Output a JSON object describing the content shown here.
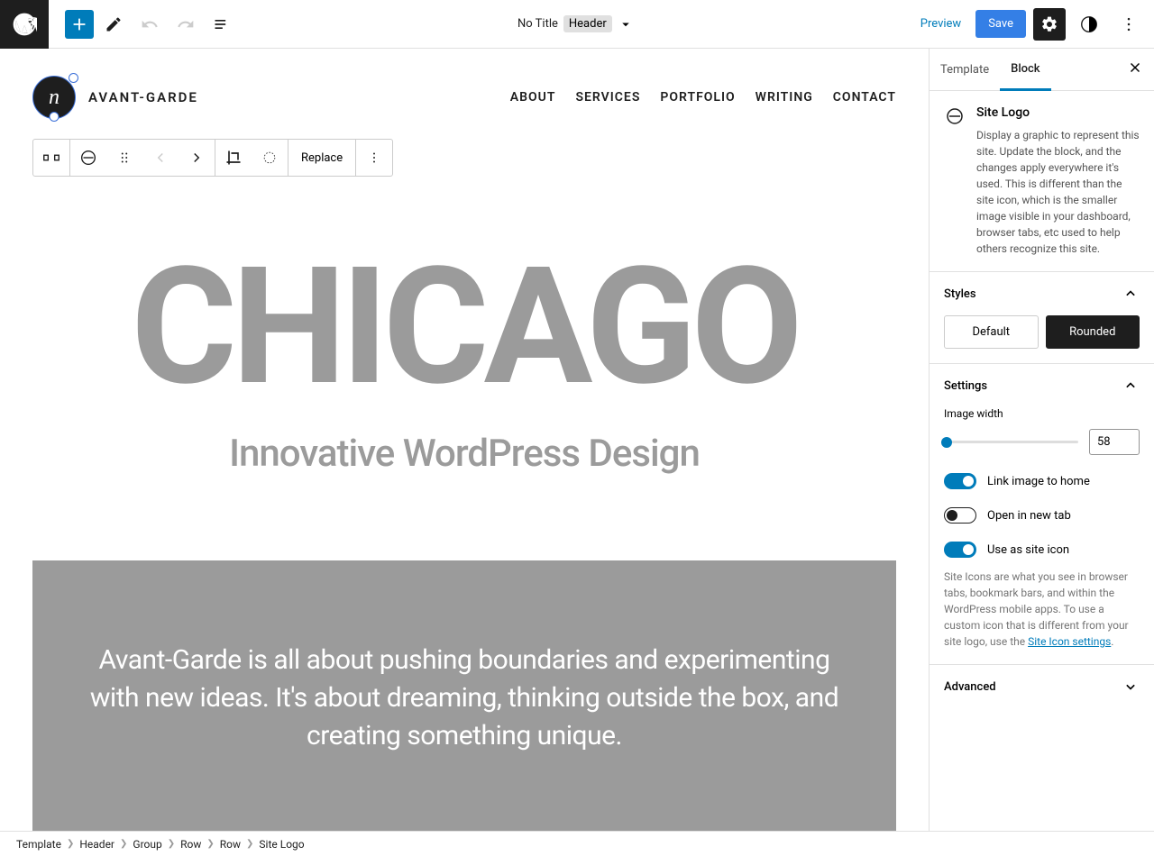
{
  "toolbar": {
    "doc_title": "No Title",
    "doc_part": "Header",
    "preview": "Preview",
    "save": "Save"
  },
  "site": {
    "title": "AVANT-GARDE",
    "nav": [
      "ABOUT",
      "SERVICES",
      "PORTFOLIO",
      "WRITING",
      "CONTACT"
    ]
  },
  "block_toolbar": {
    "replace": "Replace"
  },
  "hero": {
    "title": "CHICAGO",
    "subtitle": "Innovative WordPress Design",
    "blurb": "Avant-Garde is all about pushing boundaries and experimenting with new ideas. It's about dreaming, thinking outside the box, and creating something unique."
  },
  "sidebar": {
    "tab_template": "Template",
    "tab_block": "Block",
    "block_name": "Site Logo",
    "block_desc": "Display a graphic to represent this site. Update the block, and the changes apply everywhere it's used. This is different than the site icon, which is the smaller image visible in your dashboard, browser tabs, etc used to help others recognize this site.",
    "styles_label": "Styles",
    "style_default": "Default",
    "style_rounded": "Rounded",
    "settings_label": "Settings",
    "image_width_label": "Image width",
    "image_width_value": "58",
    "toggle_link_home": "Link image to home",
    "toggle_new_tab": "Open in new tab",
    "toggle_site_icon": "Use as site icon",
    "site_icon_help": "Site Icons are what you see in browser tabs, bookmark bars, and within the WordPress mobile apps. To use a custom icon that is different from your site logo, use the ",
    "site_icon_link": "Site Icon settings",
    "advanced_label": "Advanced"
  },
  "breadcrumb": [
    "Template",
    "Header",
    "Group",
    "Row",
    "Row",
    "Site Logo"
  ]
}
